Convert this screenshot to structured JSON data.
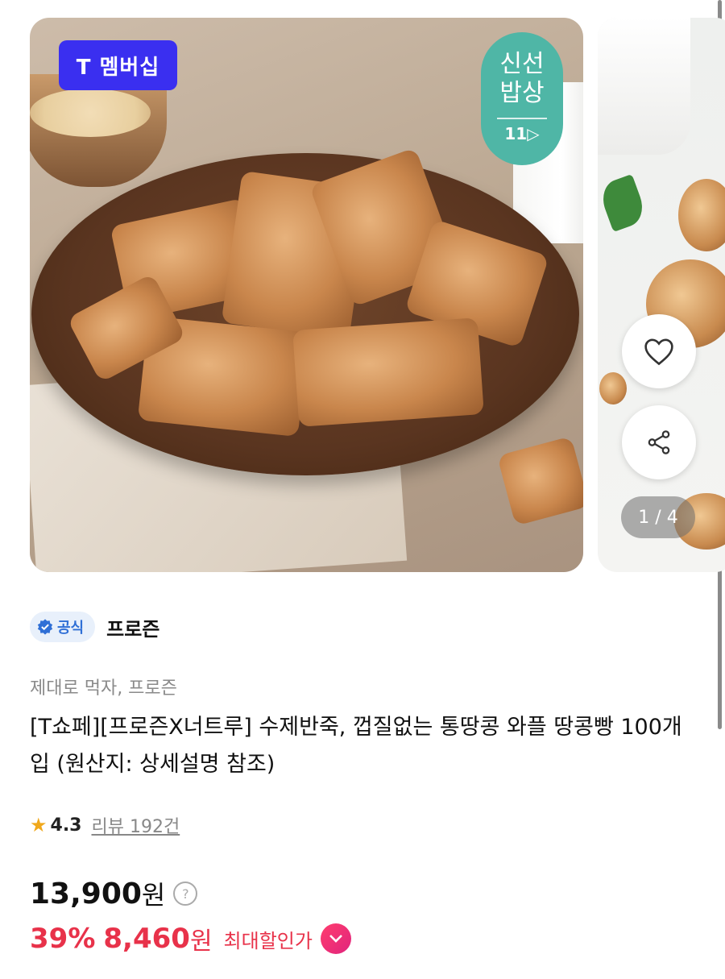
{
  "carousel": {
    "membership_badge": "T 멤버십",
    "fresh_badge": {
      "line1": "신선",
      "line2": "밥상",
      "line3": "11▷"
    },
    "pager": "1 / 4"
  },
  "product": {
    "official_label": "공식",
    "brand": "프로즌",
    "subtitle": "제대로 먹자, 프로즌",
    "title": "[T쇼페][프로즌X너트루] 수제반죽, 껍질없는 통땅콩 와플 땅콩빵 100개입 (원산지: 상세설명 참조)",
    "rating": "4.3",
    "review_label": "리뷰 192건",
    "price": "13,900",
    "price_unit": "원",
    "price_help": "?",
    "discount_pct": "39%",
    "sale_price": "8,460",
    "sale_unit": "원",
    "max_discount_label": "최대할인가"
  },
  "colors": {
    "accent_red": "#e8324a",
    "membership_blue": "#3a2ff0",
    "fresh_teal": "#4fb6a6",
    "official_blue": "#2f6fd6"
  },
  "icons": [
    "check-badge-icon",
    "heart-icon",
    "share-icon",
    "star-icon",
    "question-icon",
    "chevron-down-icon"
  ]
}
